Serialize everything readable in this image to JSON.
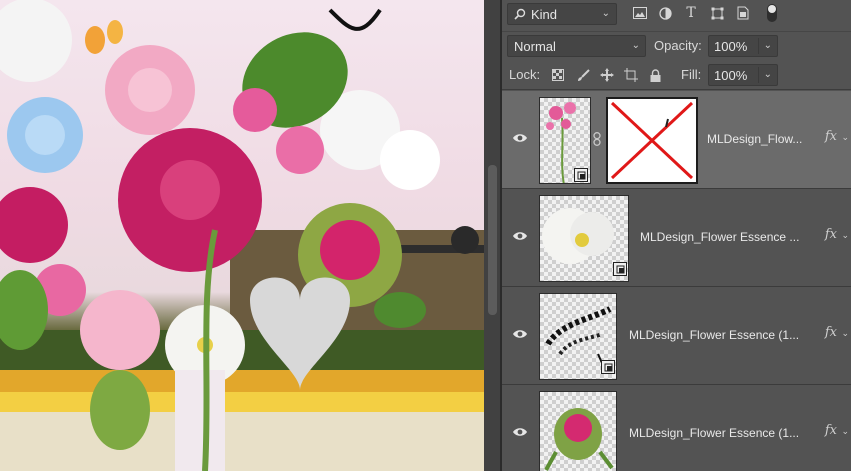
{
  "layers_panel": {
    "filter": {
      "kind_label": "Kind",
      "kind_icon": "search-icon"
    },
    "filter_icons": [
      "image-filter-icon",
      "adjustment-filter-icon",
      "type-filter-icon",
      "shape-filter-icon",
      "smart-object-filter-icon"
    ],
    "blend_mode": "Normal",
    "opacity_label": "Opacity:",
    "opacity_value": "100%",
    "lock_label": "Lock:",
    "fill_label": "Fill:",
    "fill_value": "100%",
    "lock_icons": [
      "lock-transparent-pixels-icon",
      "lock-image-pixels-icon",
      "lock-position-icon",
      "lock-artboard-icon",
      "lock-all-icon"
    ],
    "layers": [
      {
        "name": "MLDesign_Flow...",
        "fx": "fx",
        "selected": true,
        "has_mask": true
      },
      {
        "name": "MLDesign_Flower Essence ...",
        "fx": "fx",
        "selected": false,
        "has_mask": false
      },
      {
        "name": "MLDesign_Flower Essence (1...",
        "fx": "fx",
        "selected": false,
        "has_mask": false
      },
      {
        "name": "MLDesign_Flower Essence (1...",
        "fx": "fx",
        "selected": false,
        "has_mask": false
      }
    ]
  },
  "colors": {
    "panel_bg": "#535353",
    "selected_layer_bg": "#6b6b6b",
    "mask_cross": "#e01818"
  }
}
